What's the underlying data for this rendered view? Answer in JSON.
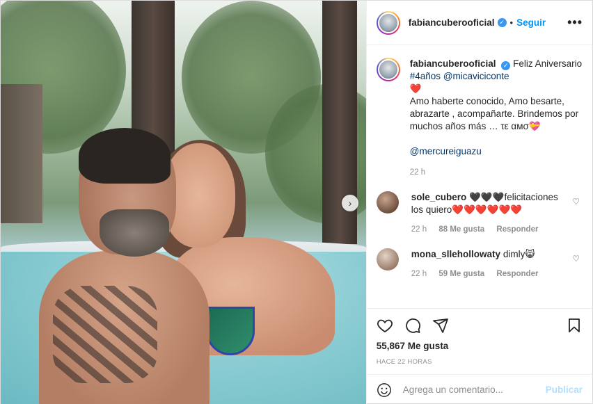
{
  "post": {
    "author": "fabiancuberooficial",
    "follow_label": "Seguir",
    "dot": "•",
    "more_label": "•••",
    "verified_mark": "✓",
    "carousel_next": "›"
  },
  "caption": {
    "username": "fabiancuberooficial",
    "text_1": "Feliz Aniversario",
    "hashtag": "#4años",
    "mention": "@micaviciconte",
    "heart": "❤️",
    "text_2": "Amo haberte conocido, Amo besarte, abrazarte , acompañarte. Brindemos por muchos años más … τε αмσ",
    "emoji_end": "💝",
    "mention_2": "@mercureiguazu",
    "time": "22 h"
  },
  "comments": [
    {
      "username": "sole_cubero",
      "text": "🖤🖤🖤felicitaciones los quiero❤️❤️❤️❤️❤️❤️",
      "time": "22 h",
      "likes": "88 Me gusta",
      "reply": "Responder",
      "like_icon": "♡"
    },
    {
      "username": "mona_sllehollowaty",
      "text": "dimly😸",
      "time": "22 h",
      "likes": "59 Me gusta",
      "reply": "Responder",
      "like_icon": "♡"
    }
  ],
  "actions": {
    "like_count": "55,867 Me gusta",
    "posted_ago": "HACE 22 HORAS"
  },
  "add_comment": {
    "placeholder": "Agrega un comentario...",
    "publish_label": "Publicar"
  }
}
